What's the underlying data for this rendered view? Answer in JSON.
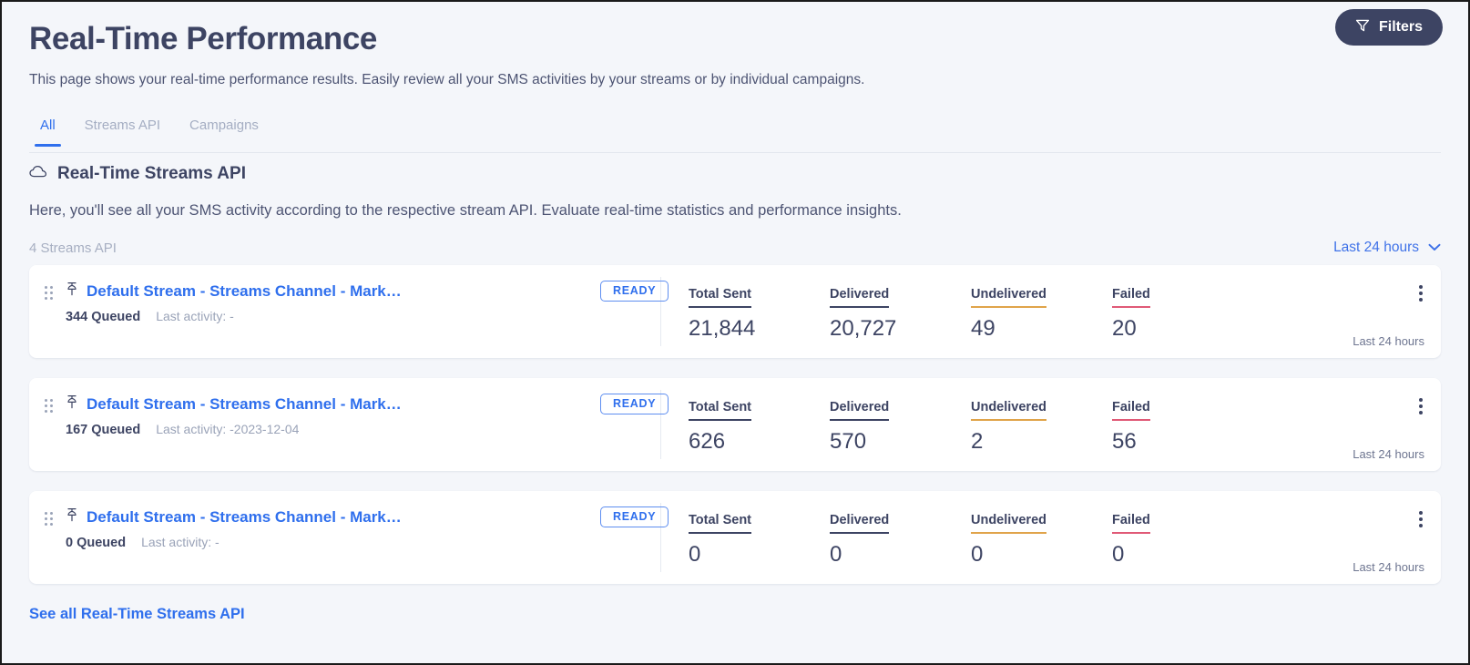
{
  "header": {
    "title": "Real-Time Performance",
    "subtitle": "This page shows your real-time performance results. Easily review all your SMS activities by your streams or by individual campaigns.",
    "filters_label": "Filters"
  },
  "tabs": [
    {
      "label": "All",
      "active": true
    },
    {
      "label": "Streams API",
      "active": false
    },
    {
      "label": "Campaigns",
      "active": false
    }
  ],
  "section": {
    "title": "Real-Time Streams API",
    "description": "Here, you'll see all your SMS activity according to the respective stream API. Evaluate real-time statistics and performance insights.",
    "count_label": "4 Streams API",
    "range_label": "Last 24 hours",
    "see_all_label": "See all Real-Time Streams API"
  },
  "metric_labels": {
    "total_sent": "Total Sent",
    "delivered": "Delivered",
    "undelivered": "Undelivered",
    "failed": "Failed"
  },
  "cards": [
    {
      "name": "Default Stream - Streams Channel - Mark…",
      "queued": "344 Queued",
      "last_activity": "Last activity: -",
      "status": "READY",
      "total_sent": "21,844",
      "delivered": "20,727",
      "undelivered": "49",
      "failed": "20",
      "range": "Last 24 hours"
    },
    {
      "name": "Default Stream - Streams Channel - Mark…",
      "queued": "167 Queued",
      "last_activity": "Last activity: -2023-12-04",
      "status": "READY",
      "total_sent": "626",
      "delivered": "570",
      "undelivered": "2",
      "failed": "56",
      "range": "Last 24 hours"
    },
    {
      "name": "Default Stream - Streams Channel - Mark…",
      "queued": "0 Queued",
      "last_activity": "Last activity: -",
      "status": "READY",
      "total_sent": "0",
      "delivered": "0",
      "undelivered": "0",
      "failed": "0",
      "range": "Last 24 hours"
    }
  ],
  "colors": {
    "accent_blue": "#2f6fed",
    "navy": "#3d4463",
    "amber": "#e0a44a",
    "pink": "#e05a77",
    "page_bg": "#f4f6fa"
  },
  "icons": {
    "filter": "funnel-icon",
    "cloud": "cloud-icon",
    "pin": "pin-icon",
    "drag": "drag-handle-icon",
    "kebab": "kebab-menu-icon",
    "chevron": "chevron-down-icon"
  }
}
